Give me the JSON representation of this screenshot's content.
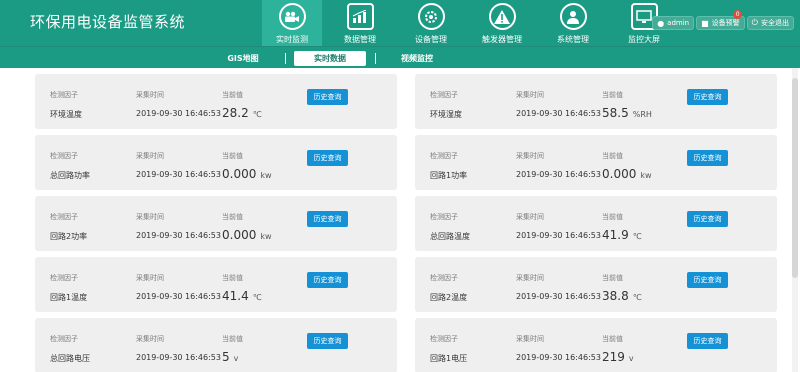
{
  "app": {
    "title": "环保用电设备监管系统"
  },
  "nav": [
    {
      "label": "实时监测"
    },
    {
      "label": "数据管理"
    },
    {
      "label": "设备管理"
    },
    {
      "label": "触发器管理"
    },
    {
      "label": "系统管理"
    },
    {
      "label": "监控大屏"
    }
  ],
  "user": {
    "name": "admin",
    "alarm_label": "设备预警",
    "alarm_count": "0",
    "logout_label": "安全退出"
  },
  "subnav": [
    {
      "label": "GIS地图"
    },
    {
      "label": "实时数据"
    },
    {
      "label": "视频监控"
    }
  ],
  "field_labels": {
    "factor": "检测因子",
    "time": "采集时间",
    "value": "当前值",
    "query_button": "历史查询"
  },
  "cards": [
    {
      "factor": "环境温度",
      "time": "2019-09-30 16:46:53",
      "value": "28.2",
      "unit": "℃"
    },
    {
      "factor": "环境湿度",
      "time": "2019-09-30 16:46:53",
      "value": "58.5",
      "unit": "%RH"
    },
    {
      "factor": "总回路功率",
      "time": "2019-09-30 16:46:53",
      "value": "0.000",
      "unit": "kw"
    },
    {
      "factor": "回路1功率",
      "time": "2019-09-30 16:46:53",
      "value": "0.000",
      "unit": "kw"
    },
    {
      "factor": "回路2功率",
      "time": "2019-09-30 16:46:53",
      "value": "0.000",
      "unit": "kw"
    },
    {
      "factor": "总回路温度",
      "time": "2019-09-30 16:46:53",
      "value": "41.9",
      "unit": "℃"
    },
    {
      "factor": "回路1温度",
      "time": "2019-09-30 16:46:53",
      "value": "41.4",
      "unit": "℃"
    },
    {
      "factor": "回路2温度",
      "time": "2019-09-30 16:46:53",
      "value": "38.8",
      "unit": "℃"
    },
    {
      "factor": "总回路电压",
      "time": "2019-09-30 16:46:53",
      "value": "5",
      "unit": "v"
    },
    {
      "factor": "回路1电压",
      "time": "2019-09-30 16:46:53",
      "value": "219",
      "unit": "v"
    }
  ]
}
